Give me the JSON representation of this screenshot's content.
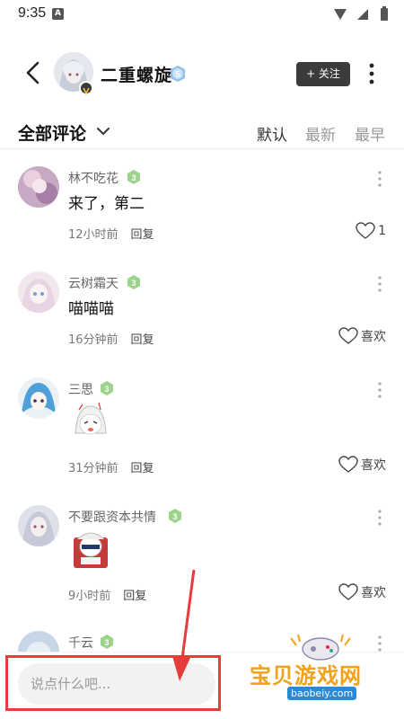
{
  "status": {
    "time": "9:35",
    "notif_letter": "A"
  },
  "header": {
    "user_name": "二重螺旋",
    "level": "5",
    "follow_label": "+ 关注"
  },
  "filter": {
    "all_label": "全部评论",
    "sort": [
      "默认",
      "最新",
      "最早"
    ],
    "active_sort": "默认"
  },
  "comments": [
    {
      "name": "林不吃花",
      "level": "3",
      "text": "来了，第二",
      "time": "12小时前",
      "reply": "回复",
      "like": "1"
    },
    {
      "name": "云树霜天",
      "level": "3",
      "text": "喵喵喵",
      "time": "16分钟前",
      "reply": "回复",
      "like": "喜欢"
    },
    {
      "name": "三思",
      "level": "3",
      "text": "",
      "time": "31分钟前",
      "reply": "回复",
      "like": "喜欢"
    },
    {
      "name": "不要跟资本共情",
      "level": "3",
      "text": "",
      "time": "9小时前",
      "reply": "回复",
      "like": "喜欢"
    },
    {
      "name": "千云",
      "level": "3"
    }
  ],
  "input": {
    "placeholder": "说点什么吧..."
  },
  "watermark": {
    "title": "宝贝游戏网",
    "url": "baobeiy.com"
  },
  "colors": {
    "level_green": "#7cc96a",
    "level_blue": "#69a8e8",
    "annotation_red": "#e63c3c"
  }
}
